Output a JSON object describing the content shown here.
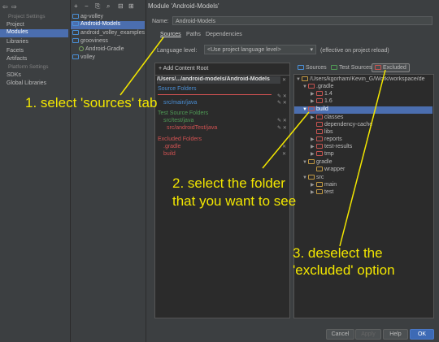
{
  "left": {
    "project_settings_header": "Project Settings",
    "items_top": [
      "Project",
      "Modules",
      "Libraries",
      "Facets",
      "Artifacts"
    ],
    "platform_settings_header": "Platform Settings",
    "items_bottom": [
      "SDKs",
      "Global Libraries"
    ]
  },
  "toolbar": {
    "icons": [
      "+",
      "−",
      "⎘",
      "⌕",
      "⊟",
      "⊞"
    ]
  },
  "module_tree": [
    "ag-volley",
    "Android-Models",
    "android_volley_examples",
    "grooviness",
    "Android-Gradle",
    "volley"
  ],
  "title": "Module 'Android-Models'",
  "name_label": "Name:",
  "name_value": "Android-Models",
  "tabs": [
    "Sources",
    "Paths",
    "Dependencies"
  ],
  "lang": {
    "label": "Language level:",
    "value": "<Use project language level>",
    "note": "(effective on project reload)"
  },
  "content_root": {
    "add_label": "+ Add Content Root",
    "path": "/Users/.../android-models/Android-Models",
    "source_header": "Source Folders",
    "source_items": [
      "src/main/java"
    ],
    "test_header": "Test Source Folders",
    "test_items": [
      "src/test/java",
      "src/androidTest/java"
    ],
    "excluded_header": "Excluded Folders",
    "excluded_items": [
      ".gradle",
      "build"
    ]
  },
  "mark_as": [
    "Sources",
    "Test Sources",
    "Excluded"
  ],
  "file_tree": {
    "root": "/Users/kgorham/Kevin_G/Work/workspace/de",
    "items": [
      ".gradle",
      "1.4",
      "1.6",
      "build",
      "classes",
      "dependency-cache",
      "libs",
      "reports",
      "test-results",
      "tmp",
      "gradle",
      "wrapper",
      "src",
      "main",
      "test"
    ]
  },
  "buttons": {
    "cancel": "Cancel",
    "apply": "Apply",
    "help": "Help",
    "ok": "OK"
  },
  "annotations": [
    "1. select 'sources' tab",
    "2. select the folder",
    "that you want to see",
    "3. deselect the",
    "'excluded' option"
  ],
  "colors": {
    "background": "#3c3f41",
    "selection": "#4b6eaf",
    "annotation": "#f2e600",
    "source": "#4a8fd6",
    "test": "#4f9a55",
    "excluded": "#d25252"
  }
}
